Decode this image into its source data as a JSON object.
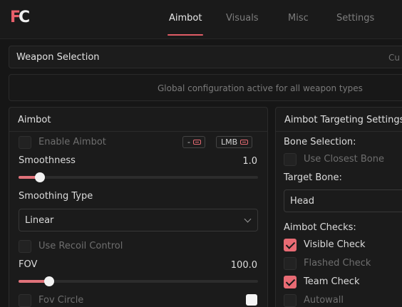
{
  "header": {
    "logo": {
      "first": "F",
      "second": "C"
    },
    "tabs": [
      {
        "label": "Aimbot",
        "active": true
      },
      {
        "label": "Visuals",
        "active": false
      },
      {
        "label": "Misc",
        "active": false
      },
      {
        "label": "Settings",
        "active": false
      }
    ]
  },
  "weapon_selection": {
    "title": "Weapon Selection",
    "right_text": "Cu",
    "info": "Global configuration active for all weapon types"
  },
  "aimbot_panel": {
    "title": "Aimbot",
    "enable_aimbot": {
      "label": "Enable Aimbot",
      "checked": false
    },
    "keybinds": [
      {
        "label": "-"
      },
      {
        "label": "LMB"
      }
    ],
    "smoothness": {
      "label": "Smoothness",
      "value": "1.0",
      "fraction": 0.07
    },
    "smoothing_type": {
      "label": "Smoothing Type",
      "selected": "Linear"
    },
    "use_recoil_control": {
      "label": "Use Recoil Control",
      "checked": false
    },
    "fov": {
      "label": "FOV",
      "value": "100.0",
      "fraction": 0.11
    },
    "fov_circle": {
      "label": "Fov Circle",
      "checked": false,
      "color": "#f4f4f4"
    }
  },
  "targeting_panel": {
    "title": "Aimbot Targeting Settings",
    "bone_selection_label": "Bone Selection:",
    "use_closest_bone": {
      "label": "Use Closest Bone",
      "checked": false
    },
    "target_bone_label": "Target Bone:",
    "target_bone": "Head",
    "checks_label": "Aimbot Checks:",
    "checks": [
      {
        "label": "Visible Check",
        "checked": true
      },
      {
        "label": "Flashed Check",
        "checked": false
      },
      {
        "label": "Team Check",
        "checked": true
      },
      {
        "label": "Autowall",
        "checked": false
      }
    ]
  },
  "colors": {
    "accent": "#e86b74",
    "background": "#161616",
    "panel": "#1b1b1b"
  }
}
